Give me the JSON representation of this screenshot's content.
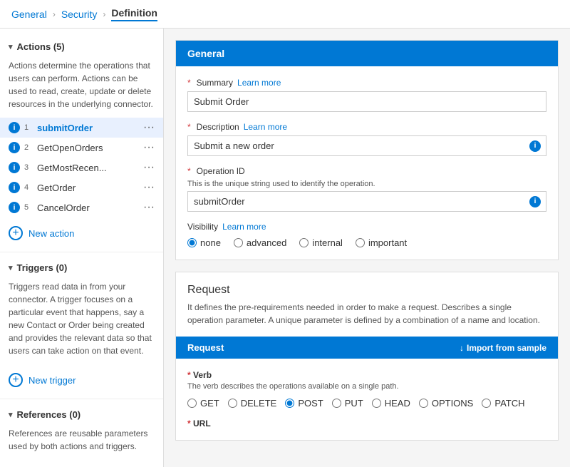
{
  "breadcrumb": {
    "items": [
      {
        "label": "General",
        "active": false
      },
      {
        "label": "Security",
        "active": false
      },
      {
        "label": "Definition",
        "active": true
      }
    ]
  },
  "sidebar": {
    "actions_header": "Actions (5)",
    "actions_desc": "Actions determine the operations that users can perform. Actions can be used to read, create, update or delete resources in the underlying connector.",
    "actions": [
      {
        "num": "1",
        "name": "submitOrder",
        "bold": true
      },
      {
        "num": "2",
        "name": "GetOpenOrders",
        "bold": false
      },
      {
        "num": "3",
        "name": "GetMostRecen...",
        "bold": false
      },
      {
        "num": "4",
        "name": "GetOrder",
        "bold": false
      },
      {
        "num": "5",
        "name": "CancelOrder",
        "bold": false
      }
    ],
    "new_action_label": "New action",
    "triggers_header": "Triggers (0)",
    "triggers_desc": "Triggers read data in from your connector. A trigger focuses on a particular event that happens, say a new Contact or Order being created and provides the relevant data so that users can take action on that event.",
    "new_trigger_label": "New trigger",
    "references_header": "References (0)",
    "references_desc": "References are reusable parameters used by both actions and triggers."
  },
  "general_card": {
    "title": "General",
    "summary_label": "Summary",
    "summary_learn_more": "Learn more",
    "summary_value": "Submit Order",
    "description_label": "Description",
    "description_learn_more": "Learn more",
    "description_value": "Submit a new order",
    "operation_id_label": "Operation ID",
    "operation_id_desc": "This is the unique string used to identify the operation.",
    "operation_id_value": "submitOrder",
    "visibility_label": "Visibility",
    "visibility_learn_more": "Learn more",
    "visibility_options": [
      "none",
      "advanced",
      "internal",
      "important"
    ],
    "visibility_selected": "none"
  },
  "request_section": {
    "title": "Request",
    "desc": "It defines the pre-requirements needed in order to make a request. Describes a single operation parameter. A unique parameter is defined by a combination of a name and location.",
    "header_label": "Request",
    "import_label": "Import from sample",
    "verb_label": "Verb",
    "verb_desc": "The verb describes the operations available on a single path.",
    "verb_options": [
      "GET",
      "DELETE",
      "POST",
      "PUT",
      "HEAD",
      "OPTIONS",
      "PATCH"
    ],
    "verb_selected": "POST",
    "url_label": "URL"
  }
}
